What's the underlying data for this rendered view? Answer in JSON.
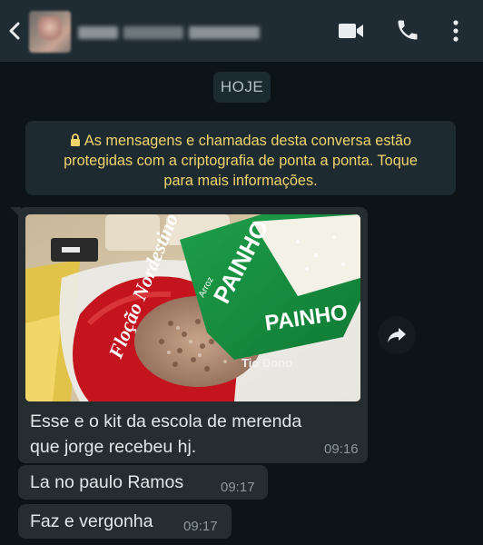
{
  "header": {
    "contact_name": "",
    "icons": [
      "arrow-left-icon",
      "video-camera-icon",
      "phone-icon",
      "more-vertical-icon"
    ]
  },
  "chat": {
    "date_label": "HOJE",
    "encryption_notice": "As mensagens e chamadas desta conversa estão protegidas com a criptografia de ponta a ponta. Toque para mais informações.",
    "encryption_notice_lines": [
      "As mensagens e chamadas desta conversa estão",
      "protegidas com a criptografia de ponta a ponta. Toque",
      "para mais informações."
    ],
    "messages": [
      {
        "type": "image",
        "caption_lines": [
          "Esse e o kit da escola de merenda",
          "que jorge recebeu hj."
        ],
        "time": "09:16",
        "photo_labels": {
          "rice_brand": "PAINHO",
          "rice_type": "Arroz",
          "beans_brand": "Floção Nordestino",
          "beans_sub": "Tio Dono"
        }
      },
      {
        "type": "text",
        "text": "La no paulo Ramos",
        "time": "09:17"
      },
      {
        "type": "text",
        "text": "Faz e vergonha",
        "time": "09:17"
      }
    ]
  },
  "colors": {
    "background": "#0d1418",
    "header": "#1f2c34",
    "bubble": "#262d31",
    "notice_text": "#f0d36a",
    "timestamp": "#8c979c"
  }
}
